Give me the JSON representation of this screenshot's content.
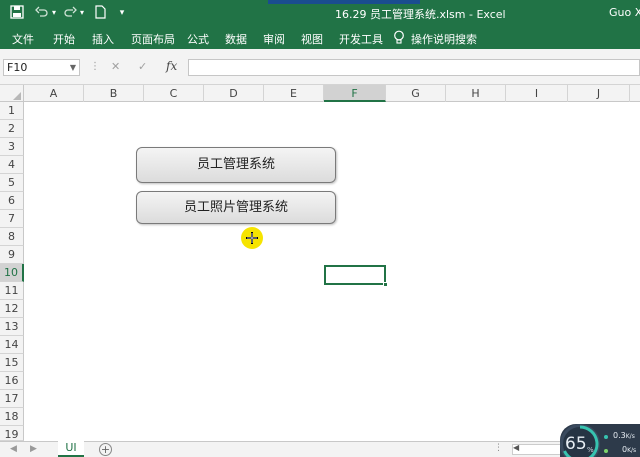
{
  "window": {
    "title": "16.29 员工管理系统.xlsm  -  Excel",
    "user": "Guo Xi",
    "accent_color": "#217346"
  },
  "quick_access": [
    "save-icon",
    "undo-icon",
    "redo-icon",
    "new-file-icon",
    "customize-icon"
  ],
  "ribbon": {
    "tabs": [
      "文件",
      "开始",
      "插入",
      "页面布局",
      "公式",
      "数据",
      "审阅",
      "视图",
      "开发工具"
    ],
    "tell_me": "操作说明搜索"
  },
  "formula_bar": {
    "name_box": "F10",
    "fx": "fx",
    "value": ""
  },
  "grid": {
    "columns": [
      "A",
      "B",
      "C",
      "D",
      "E",
      "F",
      "G",
      "H",
      "I",
      "J"
    ],
    "rows": [
      "1",
      "2",
      "3",
      "4",
      "5",
      "6",
      "7",
      "8",
      "9",
      "10",
      "11",
      "12",
      "13",
      "14",
      "15",
      "16",
      "17",
      "18",
      "19"
    ],
    "selected_column": "F",
    "selected_row": "10"
  },
  "buttons": {
    "employee_system": "员工管理系统",
    "photo_system": "员工照片管理系统"
  },
  "sheets": {
    "tabs": [
      "UI"
    ],
    "add_label": "+",
    "dots": "⋮"
  },
  "network_widget": {
    "percent": "65",
    "percent_sign": "%",
    "upload": "0.3",
    "upload_unit": "K/s",
    "download": "0",
    "download_unit": "K/s"
  }
}
